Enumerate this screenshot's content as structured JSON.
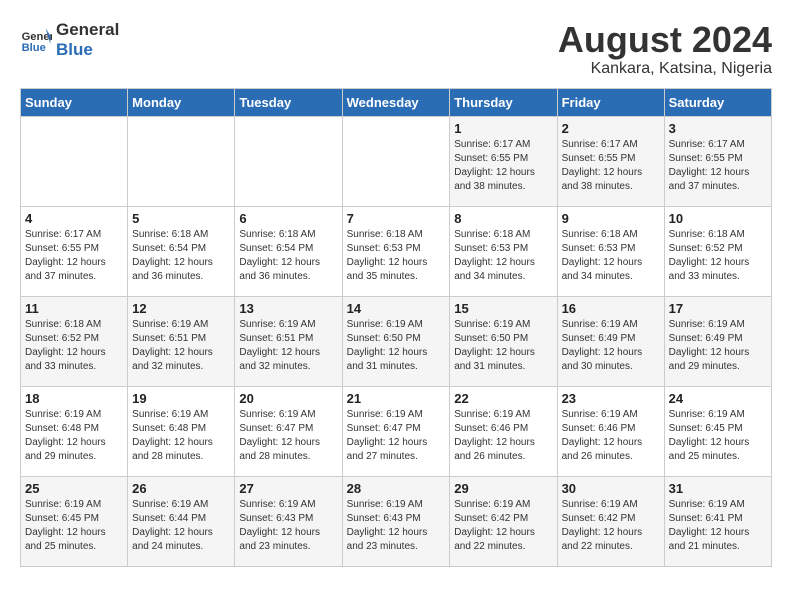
{
  "header": {
    "logo_line1": "General",
    "logo_line2": "Blue",
    "month": "August 2024",
    "location": "Kankara, Katsina, Nigeria"
  },
  "weekdays": [
    "Sunday",
    "Monday",
    "Tuesday",
    "Wednesday",
    "Thursday",
    "Friday",
    "Saturday"
  ],
  "weeks": [
    [
      {
        "day": "",
        "info": ""
      },
      {
        "day": "",
        "info": ""
      },
      {
        "day": "",
        "info": ""
      },
      {
        "day": "",
        "info": ""
      },
      {
        "day": "1",
        "info": "Sunrise: 6:17 AM\nSunset: 6:55 PM\nDaylight: 12 hours\nand 38 minutes."
      },
      {
        "day": "2",
        "info": "Sunrise: 6:17 AM\nSunset: 6:55 PM\nDaylight: 12 hours\nand 38 minutes."
      },
      {
        "day": "3",
        "info": "Sunrise: 6:17 AM\nSunset: 6:55 PM\nDaylight: 12 hours\nand 37 minutes."
      }
    ],
    [
      {
        "day": "4",
        "info": "Sunrise: 6:17 AM\nSunset: 6:55 PM\nDaylight: 12 hours\nand 37 minutes."
      },
      {
        "day": "5",
        "info": "Sunrise: 6:18 AM\nSunset: 6:54 PM\nDaylight: 12 hours\nand 36 minutes."
      },
      {
        "day": "6",
        "info": "Sunrise: 6:18 AM\nSunset: 6:54 PM\nDaylight: 12 hours\nand 36 minutes."
      },
      {
        "day": "7",
        "info": "Sunrise: 6:18 AM\nSunset: 6:53 PM\nDaylight: 12 hours\nand 35 minutes."
      },
      {
        "day": "8",
        "info": "Sunrise: 6:18 AM\nSunset: 6:53 PM\nDaylight: 12 hours\nand 34 minutes."
      },
      {
        "day": "9",
        "info": "Sunrise: 6:18 AM\nSunset: 6:53 PM\nDaylight: 12 hours\nand 34 minutes."
      },
      {
        "day": "10",
        "info": "Sunrise: 6:18 AM\nSunset: 6:52 PM\nDaylight: 12 hours\nand 33 minutes."
      }
    ],
    [
      {
        "day": "11",
        "info": "Sunrise: 6:18 AM\nSunset: 6:52 PM\nDaylight: 12 hours\nand 33 minutes."
      },
      {
        "day": "12",
        "info": "Sunrise: 6:19 AM\nSunset: 6:51 PM\nDaylight: 12 hours\nand 32 minutes."
      },
      {
        "day": "13",
        "info": "Sunrise: 6:19 AM\nSunset: 6:51 PM\nDaylight: 12 hours\nand 32 minutes."
      },
      {
        "day": "14",
        "info": "Sunrise: 6:19 AM\nSunset: 6:50 PM\nDaylight: 12 hours\nand 31 minutes."
      },
      {
        "day": "15",
        "info": "Sunrise: 6:19 AM\nSunset: 6:50 PM\nDaylight: 12 hours\nand 31 minutes."
      },
      {
        "day": "16",
        "info": "Sunrise: 6:19 AM\nSunset: 6:49 PM\nDaylight: 12 hours\nand 30 minutes."
      },
      {
        "day": "17",
        "info": "Sunrise: 6:19 AM\nSunset: 6:49 PM\nDaylight: 12 hours\nand 29 minutes."
      }
    ],
    [
      {
        "day": "18",
        "info": "Sunrise: 6:19 AM\nSunset: 6:48 PM\nDaylight: 12 hours\nand 29 minutes."
      },
      {
        "day": "19",
        "info": "Sunrise: 6:19 AM\nSunset: 6:48 PM\nDaylight: 12 hours\nand 28 minutes."
      },
      {
        "day": "20",
        "info": "Sunrise: 6:19 AM\nSunset: 6:47 PM\nDaylight: 12 hours\nand 28 minutes."
      },
      {
        "day": "21",
        "info": "Sunrise: 6:19 AM\nSunset: 6:47 PM\nDaylight: 12 hours\nand 27 minutes."
      },
      {
        "day": "22",
        "info": "Sunrise: 6:19 AM\nSunset: 6:46 PM\nDaylight: 12 hours\nand 26 minutes."
      },
      {
        "day": "23",
        "info": "Sunrise: 6:19 AM\nSunset: 6:46 PM\nDaylight: 12 hours\nand 26 minutes."
      },
      {
        "day": "24",
        "info": "Sunrise: 6:19 AM\nSunset: 6:45 PM\nDaylight: 12 hours\nand 25 minutes."
      }
    ],
    [
      {
        "day": "25",
        "info": "Sunrise: 6:19 AM\nSunset: 6:45 PM\nDaylight: 12 hours\nand 25 minutes."
      },
      {
        "day": "26",
        "info": "Sunrise: 6:19 AM\nSunset: 6:44 PM\nDaylight: 12 hours\nand 24 minutes."
      },
      {
        "day": "27",
        "info": "Sunrise: 6:19 AM\nSunset: 6:43 PM\nDaylight: 12 hours\nand 23 minutes."
      },
      {
        "day": "28",
        "info": "Sunrise: 6:19 AM\nSunset: 6:43 PM\nDaylight: 12 hours\nand 23 minutes."
      },
      {
        "day": "29",
        "info": "Sunrise: 6:19 AM\nSunset: 6:42 PM\nDaylight: 12 hours\nand 22 minutes."
      },
      {
        "day": "30",
        "info": "Sunrise: 6:19 AM\nSunset: 6:42 PM\nDaylight: 12 hours\nand 22 minutes."
      },
      {
        "day": "31",
        "info": "Sunrise: 6:19 AM\nSunset: 6:41 PM\nDaylight: 12 hours\nand 21 minutes."
      }
    ]
  ]
}
